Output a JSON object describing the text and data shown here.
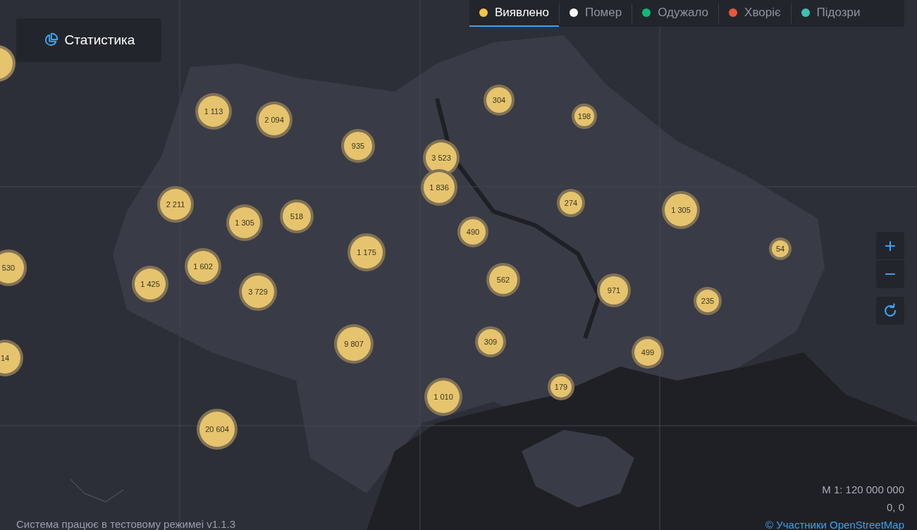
{
  "stats_button": {
    "label": "Статистика"
  },
  "legend_tabs": [
    {
      "label": "Виявлено",
      "color": "#f6c343",
      "selected": true
    },
    {
      "label": "Помер",
      "color": "#f5f5f5",
      "selected": false
    },
    {
      "label": "Одужало",
      "color": "#14b77a",
      "selected": false
    },
    {
      "label": "Хворіє",
      "color": "#e8573a",
      "selected": false
    },
    {
      "label": "Підозри",
      "color": "#3cc1b5",
      "selected": false
    }
  ],
  "markers": [
    {
      "count": "1 113"
    },
    {
      "count": "2 094"
    },
    {
      "count": "935"
    },
    {
      "count": "3 523"
    },
    {
      "count": "1 836"
    },
    {
      "count": "304"
    },
    {
      "count": "198"
    },
    {
      "count": "2 211"
    },
    {
      "count": "1 305"
    },
    {
      "count": "518"
    },
    {
      "count": "490"
    },
    {
      "count": "274"
    },
    {
      "count": "1 305"
    },
    {
      "count": "54"
    },
    {
      "count": "1 175"
    },
    {
      "count": "1 602"
    },
    {
      "count": "1 425"
    },
    {
      "count": "3 729"
    },
    {
      "count": "562"
    },
    {
      "count": "971"
    },
    {
      "count": "235"
    },
    {
      "count": "530"
    },
    {
      "count": "9 807"
    },
    {
      "count": "309"
    },
    {
      "count": "499"
    },
    {
      "count": "14"
    },
    {
      "count": "179"
    },
    {
      "count": "1 010"
    },
    {
      "count": "20 604"
    },
    {
      "kind": "cluster"
    }
  ],
  "zoom_controls": {
    "zoom_in": "+",
    "zoom_out": "−"
  },
  "scale": "M 1: 120 000 000",
  "coordinates": "0, 0",
  "attribution": "© Участники OpenStreetMap",
  "status": "Система працює в тестовому режимеі v1.1.3"
}
